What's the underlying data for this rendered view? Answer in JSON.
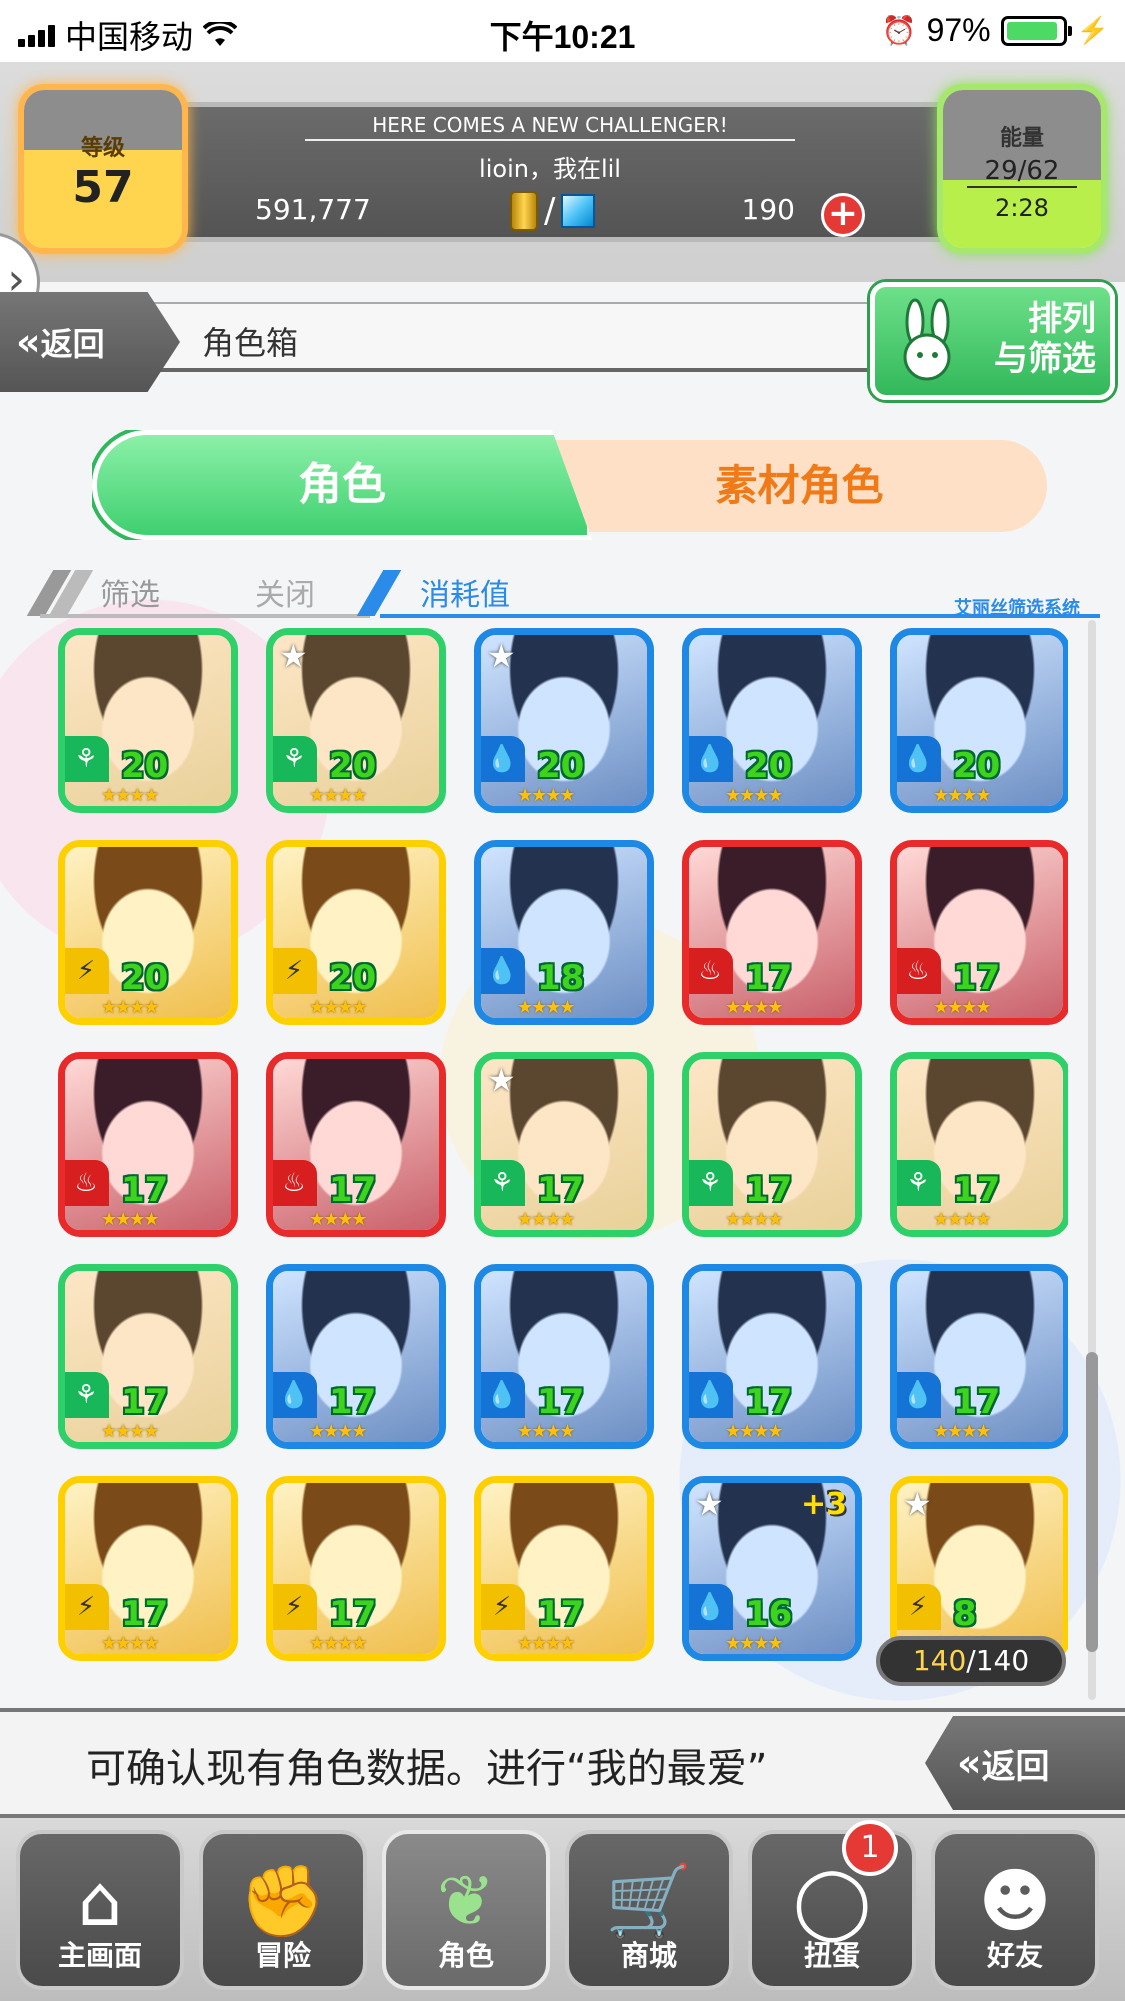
{
  "status_bar": {
    "carrier": "中国移动",
    "time": "下午10:21",
    "battery_percent": "97%",
    "battery_level": 0.97
  },
  "header": {
    "level_label": "等级",
    "level_value": "57",
    "banner": "HERE COMES A NEW CHALLENGER!",
    "message": "lioin，我在lil",
    "gold": "591,777",
    "currency_separator": "/",
    "gems": "190",
    "energy_label": "能量",
    "energy_value": "29/62",
    "energy_timer": "2:28"
  },
  "nav_bar": {
    "back_label": "返回",
    "page_title": "角色箱",
    "sort_filter_label_line1": "排列",
    "sort_filter_label_line2": "与筛选"
  },
  "tabs": [
    {
      "label": "角色",
      "active": true
    },
    {
      "label": "素材角色",
      "active": false
    }
  ],
  "filter": {
    "filter_label": "筛选",
    "filter_state": "关闭",
    "sort_label": "消耗值",
    "system_label": "艾丽丝筛选系统"
  },
  "characters": [
    {
      "border": "green",
      "element": "wood",
      "cost": "20",
      "stars": "★★★★",
      "star_badge": false,
      "plus": ""
    },
    {
      "border": "green",
      "element": "wood",
      "cost": "20",
      "stars": "★★★★",
      "star_badge": true,
      "plus": ""
    },
    {
      "border": "blue",
      "element": "water",
      "cost": "20",
      "stars": "★★★★",
      "star_badge": true,
      "plus": ""
    },
    {
      "border": "blue",
      "element": "water",
      "cost": "20",
      "stars": "★★★★",
      "star_badge": false,
      "plus": ""
    },
    {
      "border": "blue",
      "element": "water",
      "cost": "20",
      "stars": "★★★★",
      "star_badge": false,
      "plus": ""
    },
    {
      "border": "yellow",
      "element": "light",
      "cost": "20",
      "stars": "★★★★",
      "star_badge": false,
      "plus": ""
    },
    {
      "border": "yellow",
      "element": "light",
      "cost": "20",
      "stars": "★★★★",
      "star_badge": false,
      "plus": ""
    },
    {
      "border": "blue",
      "element": "water",
      "cost": "18",
      "stars": "★★★★",
      "star_badge": false,
      "plus": ""
    },
    {
      "border": "red",
      "element": "fire",
      "cost": "17",
      "stars": "★★★★",
      "star_badge": false,
      "plus": ""
    },
    {
      "border": "red",
      "element": "fire",
      "cost": "17",
      "stars": "★★★★",
      "star_badge": false,
      "plus": ""
    },
    {
      "border": "red",
      "element": "fire",
      "cost": "17",
      "stars": "★★★★",
      "star_badge": false,
      "plus": ""
    },
    {
      "border": "red",
      "element": "fire",
      "cost": "17",
      "stars": "★★★★",
      "star_badge": false,
      "plus": ""
    },
    {
      "border": "green",
      "element": "wood",
      "cost": "17",
      "stars": "★★★★",
      "star_badge": true,
      "plus": ""
    },
    {
      "border": "green",
      "element": "wood",
      "cost": "17",
      "stars": "★★★★",
      "star_badge": false,
      "plus": ""
    },
    {
      "border": "green",
      "element": "wood",
      "cost": "17",
      "stars": "★★★★",
      "star_badge": false,
      "plus": ""
    },
    {
      "border": "green",
      "element": "wood",
      "cost": "17",
      "stars": "★★★★",
      "star_badge": false,
      "plus": ""
    },
    {
      "border": "blue",
      "element": "water",
      "cost": "17",
      "stars": "★★★★",
      "star_badge": false,
      "plus": ""
    },
    {
      "border": "blue",
      "element": "water",
      "cost": "17",
      "stars": "★★★★",
      "star_badge": false,
      "plus": ""
    },
    {
      "border": "blue",
      "element": "water",
      "cost": "17",
      "stars": "★★★★",
      "star_badge": false,
      "plus": ""
    },
    {
      "border": "blue",
      "element": "water",
      "cost": "17",
      "stars": "★★★★",
      "star_badge": false,
      "plus": ""
    },
    {
      "border": "yellow",
      "element": "light",
      "cost": "17",
      "stars": "★★★★",
      "star_badge": false,
      "plus": ""
    },
    {
      "border": "yellow",
      "element": "light",
      "cost": "17",
      "stars": "★★★★",
      "star_badge": false,
      "plus": ""
    },
    {
      "border": "yellow",
      "element": "light",
      "cost": "17",
      "stars": "★★★★",
      "star_badge": false,
      "plus": ""
    },
    {
      "border": "blue",
      "element": "water",
      "cost": "16",
      "stars": "★★★★",
      "star_badge": true,
      "plus": "+3"
    },
    {
      "border": "yellow",
      "element": "light",
      "cost": "8",
      "stars": "★★★★",
      "star_badge": true,
      "plus": ""
    }
  ],
  "box_count": {
    "current": "140",
    "separator": "/",
    "max": "140"
  },
  "message_bar": {
    "text": "可确认现有角色数据。进行“我的最爱”",
    "back_label": "返回"
  },
  "bottom_nav": [
    {
      "label": "主画面",
      "icon": "home-icon",
      "active": false,
      "badge": ""
    },
    {
      "label": "冒险",
      "icon": "handshake-icon",
      "active": false,
      "badge": ""
    },
    {
      "label": "角色",
      "icon": "bunny-icon",
      "active": true,
      "badge": ""
    },
    {
      "label": "商城",
      "icon": "cart-icon",
      "active": false,
      "badge": ""
    },
    {
      "label": "扭蛋",
      "icon": "egg-icon",
      "active": false,
      "badge": "1"
    },
    {
      "label": "好友",
      "icon": "friends-icon",
      "active": false,
      "badge": ""
    }
  ],
  "colors": {
    "green": "#2ed06a",
    "blue": "#1e88e5",
    "yellow": "#ffd000",
    "red": "#e82a2a",
    "accent_blue": "#2a8be8",
    "tab_orange": "#f07a18"
  }
}
